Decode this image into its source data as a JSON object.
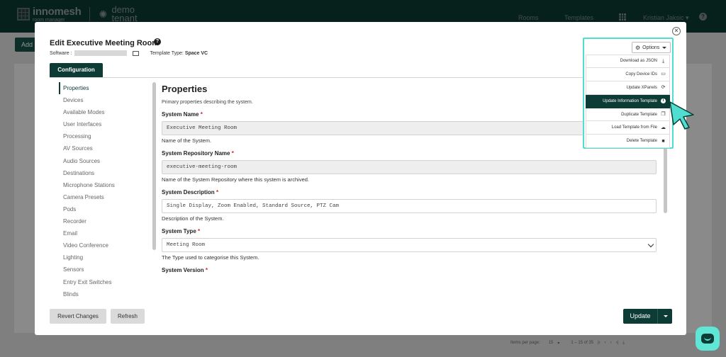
{
  "app": {
    "logo_brand": "innomesh",
    "logo_sub": "room manager",
    "tenant_name": "demo tenant"
  },
  "nav": {
    "rooms": "Rooms",
    "templates": "Templates",
    "user": "Kristian Jaksic"
  },
  "page": {
    "add_button": "Add",
    "items_per_page_label": "Items per page:",
    "items_per_page_value": "15",
    "range_label": "1 – 15 of 35"
  },
  "modal": {
    "title": "Edit Executive Meeting Room",
    "software_label": "Software :",
    "template_type_label": "Template Type:",
    "template_type_value": "Space VC",
    "tab_label": "Configuration",
    "side_nav": [
      "Properties",
      "Devices",
      "Available Modes",
      "User Interfaces",
      "Processing",
      "AV Sources",
      "Audio Sources",
      "Destinations",
      "Microphone Stations",
      "Camera Presets",
      "Pods",
      "Recorder",
      "Email",
      "Video Conference",
      "Lighting",
      "Sensors",
      "Entry Exit Switches",
      "Blinds"
    ],
    "section_title": "Properties",
    "section_desc": "Primary properties describing the system.",
    "fields": {
      "name": {
        "label": "System Name",
        "value": "Executive Meeting Room",
        "help": "Name of the System."
      },
      "repo": {
        "label": "System Repository Name",
        "value": "executive-meeting-room",
        "help": "Name of the System Repository where this system is archived."
      },
      "desc": {
        "label": "System Description",
        "value": "Single Display, Zoom Enabled, Standard Source, PTZ Cam",
        "help": "Description of the System."
      },
      "type": {
        "label": "System Type",
        "value": "Meeting Room",
        "help": "The Type used to categorise this System."
      },
      "version": {
        "label": "System Version"
      }
    },
    "required_mark": "*",
    "buttons": {
      "revert": "Revert Changes",
      "refresh": "Refresh",
      "update": "Update"
    },
    "options": {
      "button_label": "Options",
      "items": [
        {
          "label": "Download as JSON",
          "icon": "download-icon"
        },
        {
          "label": "Copy Device IDs",
          "icon": "monitor-icon"
        },
        {
          "label": "Update XPanels",
          "icon": "sync-icon"
        },
        {
          "label": "Update Information Template",
          "icon": "info-icon",
          "highlighted": true
        },
        {
          "label": "Duplicate Template",
          "icon": "copy-icon"
        },
        {
          "label": "Load Template from File",
          "icon": "cloud-upload-icon"
        },
        {
          "label": "Delete Template",
          "icon": "trash-icon"
        }
      ]
    }
  },
  "colors": {
    "brand_dark": "#0d3b35",
    "highlight_border": "#4fded0",
    "required": "#d8232a"
  }
}
